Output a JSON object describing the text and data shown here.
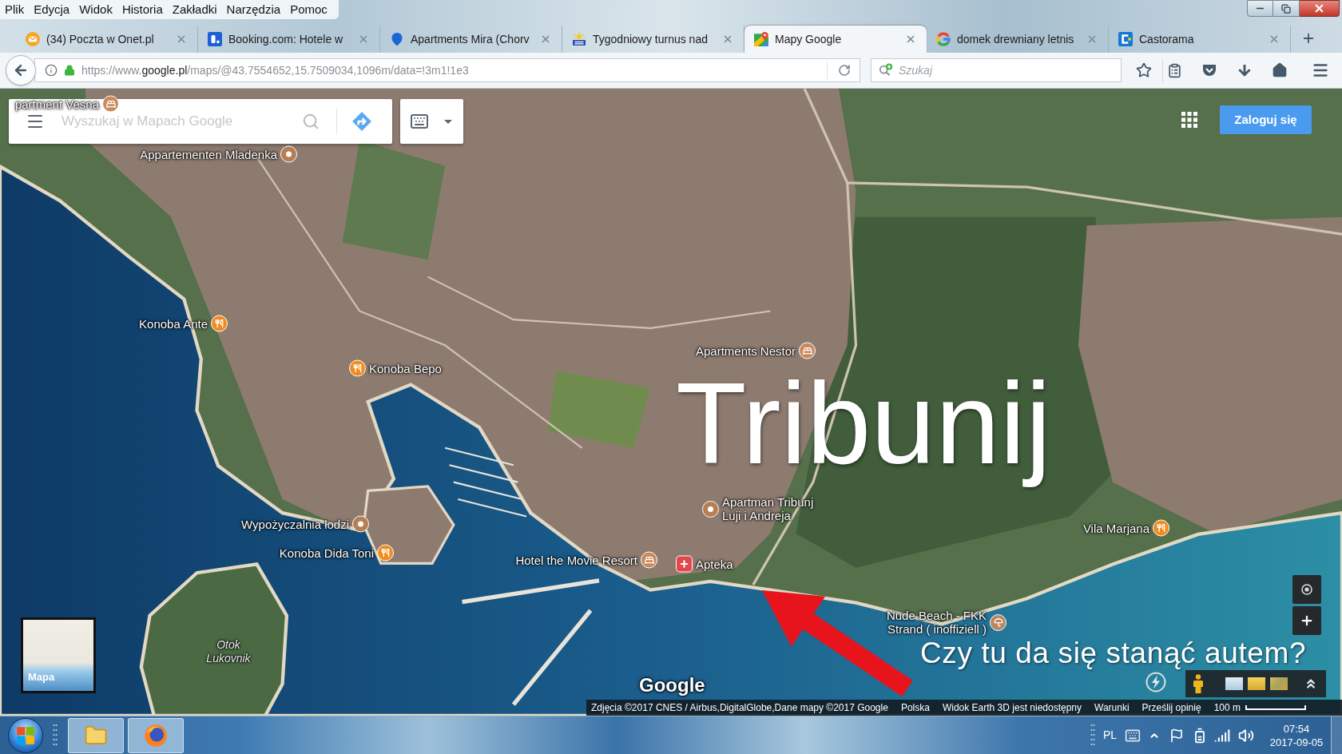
{
  "menu_bar": {
    "items": [
      "Plik",
      "Edycja",
      "Widok",
      "Historia",
      "Zakładki",
      "Narzędzia",
      "Pomoc"
    ]
  },
  "tabs": [
    {
      "title": "(34) Poczta w Onet.pl",
      "selected": false
    },
    {
      "title": "Booking.com: Hotele w",
      "selected": false
    },
    {
      "title": "Apartments Mira (Chorv",
      "selected": false
    },
    {
      "title": "Tygodniowy turnus nad",
      "selected": false
    },
    {
      "title": "Mapy Google",
      "selected": true
    },
    {
      "title": "domek drewniany letnis",
      "selected": false
    },
    {
      "title": "Castorama",
      "selected": false
    }
  ],
  "address_bar": {
    "scheme": "https://www.",
    "domain": "google.pl",
    "path": "/maps/@43.7554652,15.7509034,1096m/data=!3m1!1e3"
  },
  "browser_search": {
    "placeholder": "Szukaj"
  },
  "map": {
    "search": {
      "placeholder": "Wyszukaj w Mapach Google"
    },
    "sign_in": "Zaloguj się",
    "places": [
      {
        "label": "partment Vesna",
        "kind": "hotel"
      },
      {
        "label": "Appartementen Mladenka",
        "kind": "place"
      },
      {
        "label": "Konoba Ante",
        "kind": "restaurant"
      },
      {
        "label": "Konoba Bepo",
        "kind": "restaurant"
      },
      {
        "label": "Apartments Nestor",
        "kind": "hotel"
      },
      {
        "label": "Apartman Tribunj Luji i Andreja",
        "kind": "place"
      },
      {
        "label": "Wypożyczalnia łodzi",
        "kind": "place"
      },
      {
        "label": "Konoba Dida Toni",
        "kind": "restaurant"
      },
      {
        "label": "Hotel the Movie Resort",
        "kind": "hotel"
      },
      {
        "label": "Apteka",
        "kind": "pharmacy"
      },
      {
        "label": "Vila Marjana",
        "kind": "restaurant"
      },
      {
        "label": "Nude Beach - FKK Strand ( inoffiziell )",
        "kind": "beach"
      }
    ],
    "island_label": "Otok Lukovnik",
    "minimap_label": "Mapa",
    "logo": "Google",
    "attribution": {
      "credits": "Zdjęcia ©2017 CNES / Airbus,DigitalGlobe,Dane mapy ©2017 Google",
      "region": "Polska",
      "notice": "Widok Earth 3D jest niedostępny",
      "links": [
        "Warunki",
        "Prześlij opinię"
      ]
    },
    "scale": "100 m"
  },
  "annotations": {
    "title": "Tribunij",
    "question": "Czy tu da się stanąć autem?"
  },
  "taskbar": {
    "language": "PL",
    "time": "07:54",
    "date": "2017-09-05"
  }
}
